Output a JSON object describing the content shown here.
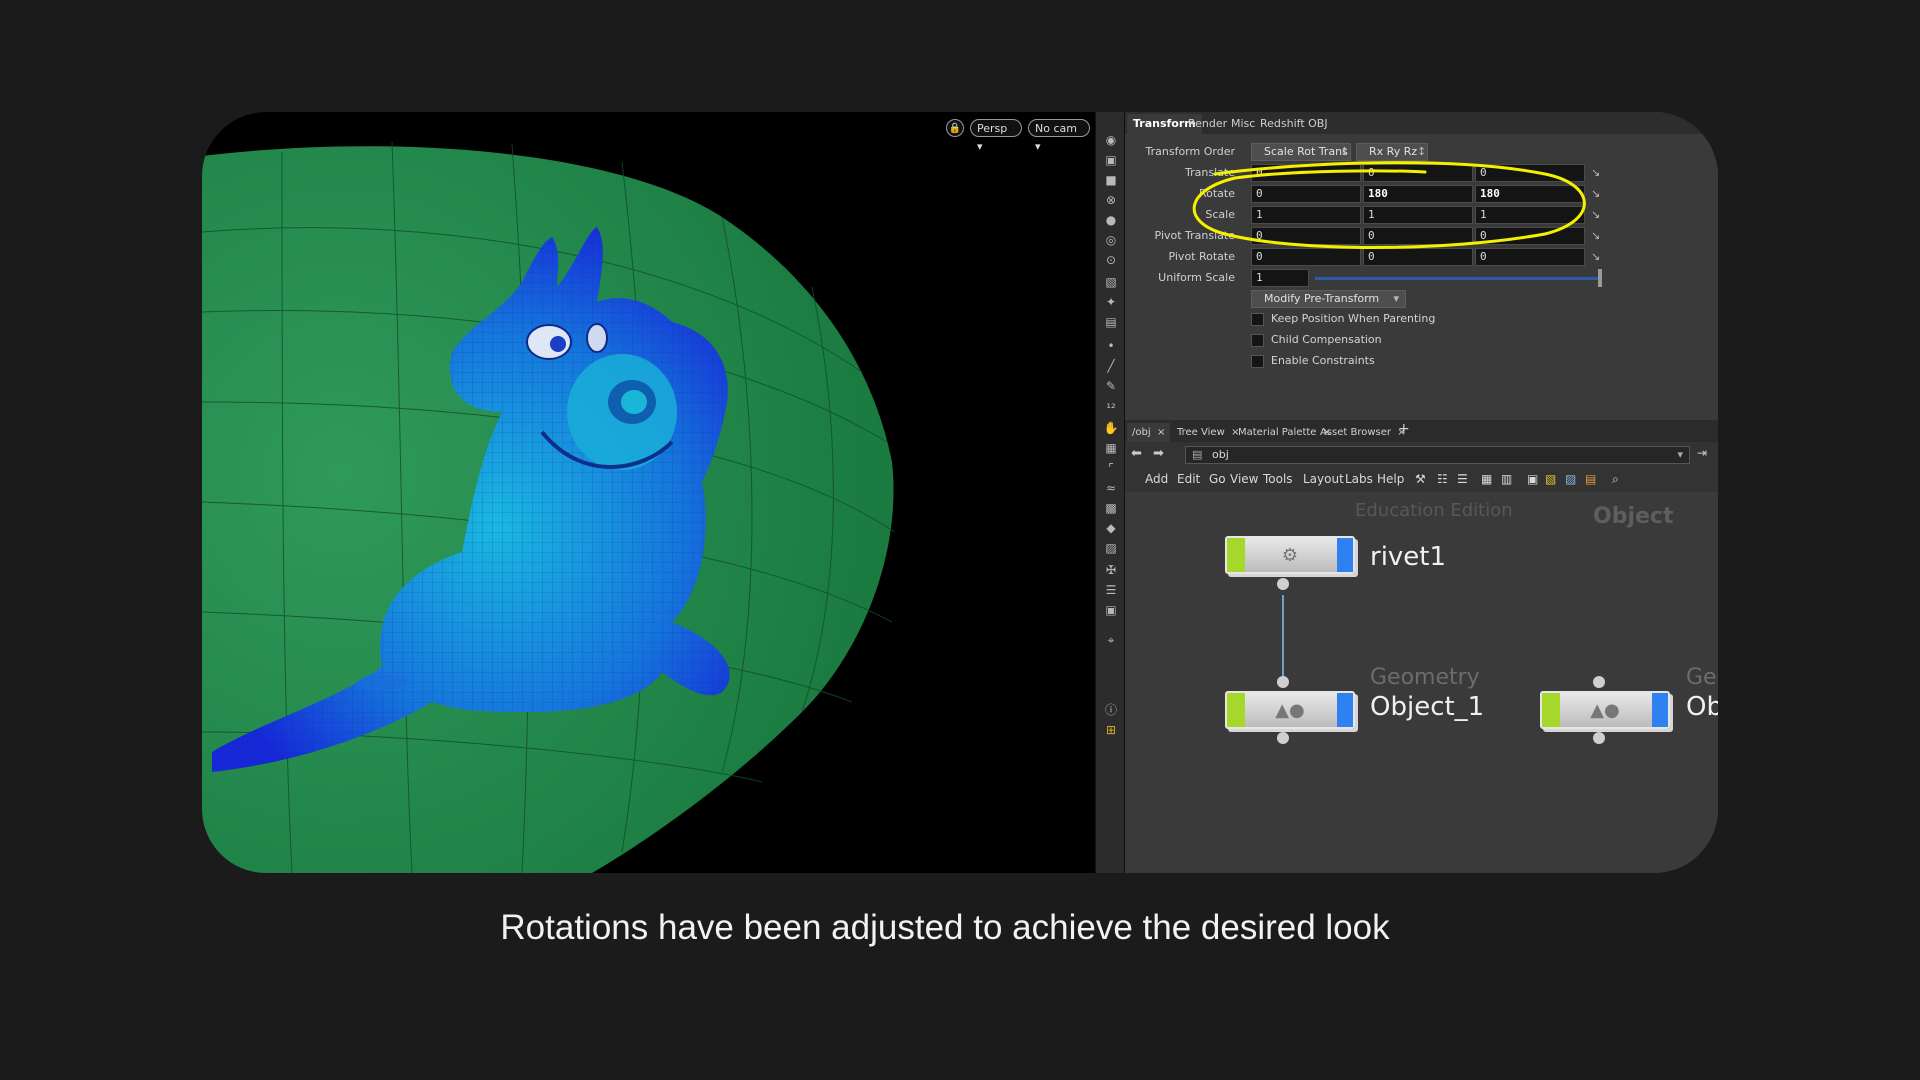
{
  "viewport": {
    "lock_icon": "lock-icon",
    "persp_label": "Persp",
    "cam_label": "No cam"
  },
  "params": {
    "tabs": [
      "Transform",
      "Render",
      "Misc",
      "Redshift OBJ"
    ],
    "transform_order_label": "Transform Order",
    "transform_order_value": "Scale Rot Trans",
    "rotate_order_value": "Rx Ry Rz",
    "rows": [
      {
        "label": "Translate",
        "values": [
          "0",
          "0",
          "0"
        ]
      },
      {
        "label": "Rotate",
        "values": [
          "0",
          "180",
          "180"
        ]
      },
      {
        "label": "Scale",
        "values": [
          "1",
          "1",
          "1"
        ]
      },
      {
        "label": "Pivot Translate",
        "values": [
          "0",
          "0",
          "0"
        ]
      },
      {
        "label": "Pivot Rotate",
        "values": [
          "0",
          "0",
          "0"
        ]
      }
    ],
    "uniform_scale_label": "Uniform Scale",
    "uniform_scale_value": "1",
    "modify_label": "Modify Pre-Transform",
    "checkboxes": [
      "Keep Position When Parenting",
      "Child Compensation",
      "Enable Constraints"
    ],
    "highlight_color": "#f3f000"
  },
  "network": {
    "tabs": [
      "/obj",
      "Tree View",
      "Material Palette",
      "Asset Browser"
    ],
    "path": "obj",
    "menu": [
      "Add",
      "Edit",
      "Go",
      "View",
      "Tools",
      "Layout",
      "Labs",
      "Help"
    ],
    "watermark": "Education Edition",
    "context_label": "Object",
    "nodes": [
      {
        "name": "rivet1",
        "type": ""
      },
      {
        "name": "Object_1",
        "type": "Geometry"
      },
      {
        "name": "Ob",
        "type": "Geo"
      }
    ]
  },
  "caption": "Rotations have been adjusted to achieve the desired look"
}
